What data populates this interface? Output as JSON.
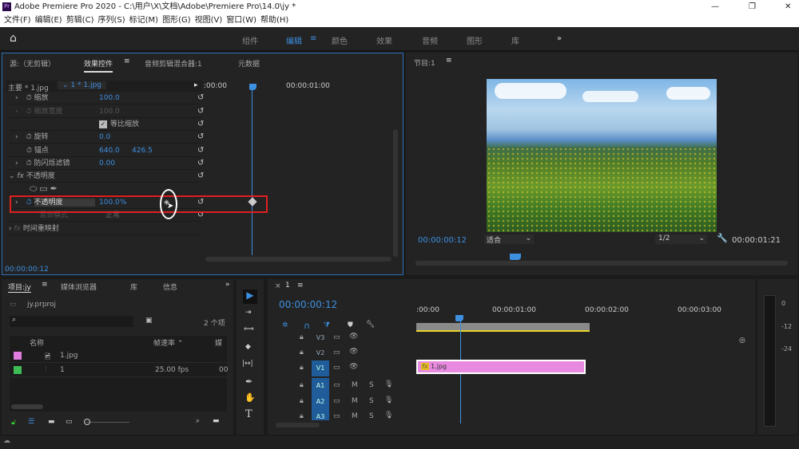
{
  "window": {
    "title": "Adobe Premiere Pro 2020 - C:\\用户\\X\\文档\\Adobe\\Premiere Pro\\14.0\\jy *",
    "controls": [
      "—",
      "❐",
      "✕"
    ]
  },
  "menu": [
    "文件(F)",
    "编辑(E)",
    "剪辑(C)",
    "序列(S)",
    "标记(M)",
    "图形(G)",
    "视图(V)",
    "窗口(W)",
    "帮助(H)"
  ],
  "workspaces": {
    "items": [
      "组件",
      "编辑",
      "颜色",
      "效果",
      "音频",
      "图形",
      "库"
    ],
    "active": "编辑",
    "more": "»"
  },
  "effect_panel": {
    "tabs": [
      "源:（无剪辑）",
      "效果控件",
      "音频剪辑混合器:1",
      "元数据"
    ],
    "active_tab": "效果控件",
    "master": "主要 * 1.jpg",
    "clip": "1 * 1.jpg",
    "ruler": [
      ":00:00",
      "00:00:01:00"
    ],
    "rows": [
      {
        "label": "缩放",
        "value": "100.0"
      },
      {
        "label": "缩放宽度",
        "value": "100.0"
      },
      {
        "label": "等比缩放",
        "checked": true
      },
      {
        "label": "旋转",
        "value": "0.0"
      },
      {
        "label": "锚点",
        "value": "640.0",
        "value2": "426.5"
      },
      {
        "label": "防闪烁滤镜",
        "value": "0.00"
      },
      {
        "label": "不透明度",
        "fx": "fx"
      },
      {
        "label": "不透明度",
        "value": "100.0",
        "unit": "%"
      },
      {
        "label": "混合模式",
        "value": "正常"
      },
      {
        "label": "时间重映射",
        "fx": "fx"
      }
    ],
    "timecode": "00:00:00:12",
    "highlight_color": "#e02020"
  },
  "program": {
    "title": "节目:1",
    "timecode": "00:00:00:12",
    "fit": "适合",
    "quality": "1/2",
    "duration": "00:00:01:21"
  },
  "project": {
    "tabs": [
      "项目:jy",
      "媒体浏览器",
      "库",
      "信息"
    ],
    "file": "jy.prproj",
    "count": "2 个项",
    "columns": [
      "名称",
      "帧速率",
      "媒"
    ],
    "items": [
      {
        "name": "1.jpg",
        "color": "#e07be0",
        "fps": "",
        "media": ""
      },
      {
        "name": "1",
        "color": "#3dbb55",
        "fps": "25.00 fps",
        "media": "00"
      }
    ]
  },
  "timeline": {
    "tab": "1",
    "timecode": "00:00:00:12",
    "ruler": [
      ":00:00",
      "00:00:01:00",
      "00:00:02:00",
      "00:00:03:00"
    ],
    "tracks": [
      "V3",
      "V2",
      "V1",
      "A1",
      "A2",
      "A3"
    ],
    "clip": "1.jpg",
    "clip_fx": "fx",
    "clip_color": "#e88be0",
    "meter": [
      "0",
      "-12",
      "-24"
    ],
    "M": "M",
    "S": "S"
  },
  "tools": [
    "▶",
    "⇥",
    "⟺",
    "◆",
    "|↔|",
    "✒",
    "✋",
    "T"
  ]
}
